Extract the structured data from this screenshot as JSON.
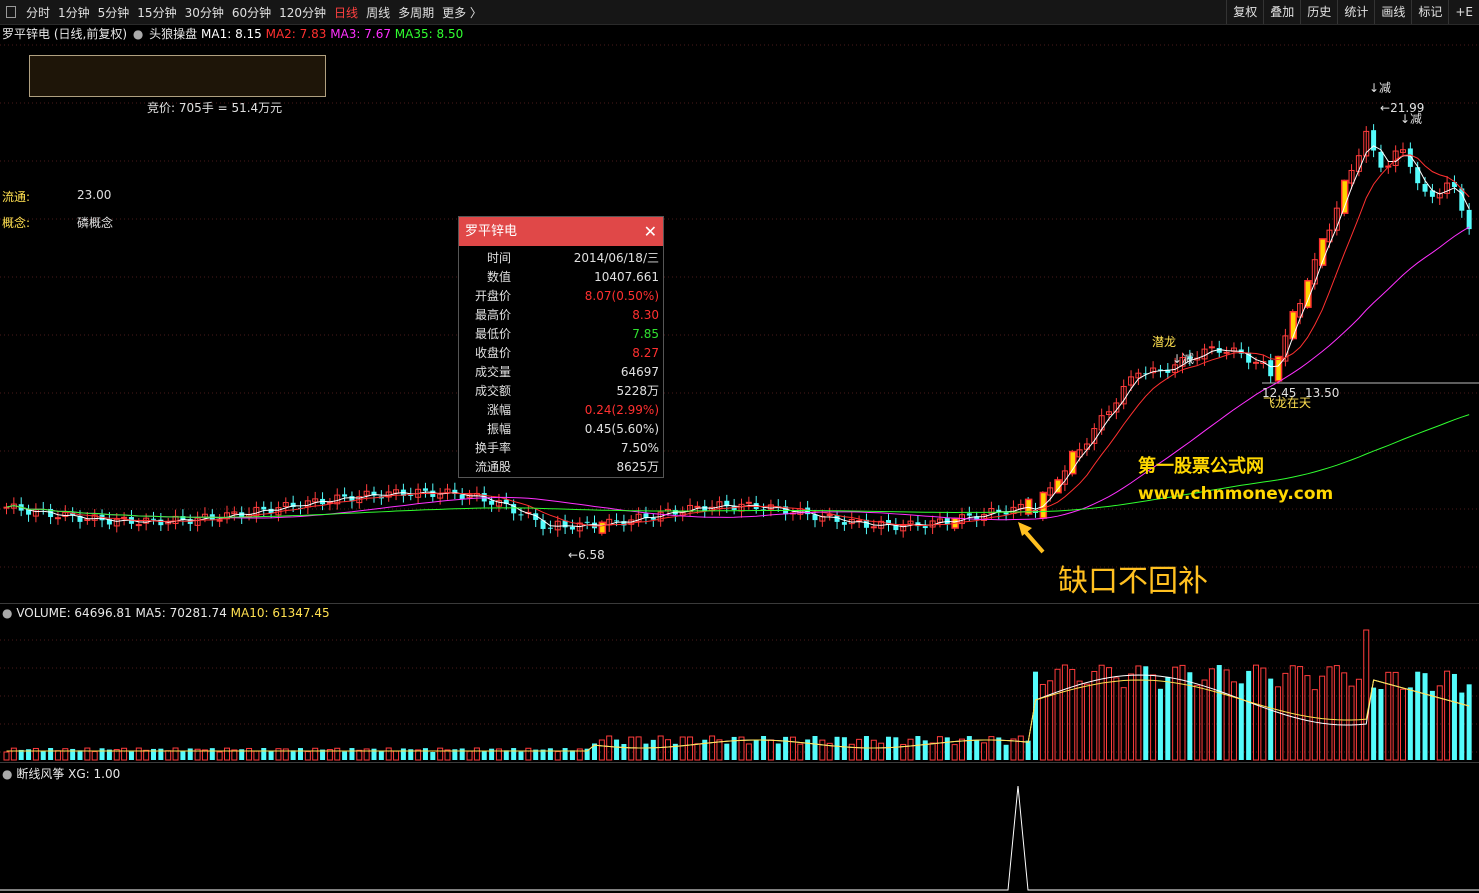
{
  "toolbar": {
    "periods": [
      "分时",
      "1分钟",
      "5分钟",
      "15分钟",
      "30分钟",
      "60分钟",
      "120分钟",
      "日线",
      "周线",
      "多周期",
      "更多 〉"
    ],
    "active_period": "日线",
    "right_buttons": [
      "复权",
      "叠加",
      "历史",
      "统计",
      "画线",
      "标记"
    ],
    "more_label": "+E"
  },
  "main_pane": {
    "stock_name": "罗平锌电",
    "period_desc": "(日线,前复权)",
    "indicator_name": "头狼操盘",
    "ma": [
      {
        "label": "MA1: 8.15",
        "color": "#ffffff"
      },
      {
        "label": "MA2: 7.83",
        "color": "#ff3030"
      },
      {
        "label": "MA3: 7.67",
        "color": "#ff30ff"
      },
      {
        "label": "MA35: 8.50",
        "color": "#30ff30"
      }
    ],
    "auction": "竞价: 705手 = 51.4万元",
    "float_label": "流通:",
    "float_value": "23.00",
    "concept_label": "概念:",
    "concept_value": "磷概念",
    "low_label": "6.58",
    "high_label": "21.99",
    "level_label_1": "12.45",
    "level_label_2": "13.50",
    "sig_qianlong": "潜龙",
    "sig_jian": "↓减",
    "sig_feilong": "飞龙在天",
    "watermark_cn": "第一股票公式网",
    "watermark_url": "www.chnmoney.com",
    "annotation": "缺口不回补"
  },
  "tooltip": {
    "title": "罗平锌电",
    "rows": [
      {
        "k": "时间",
        "v": "2014/06/18/三",
        "c": "#e0e0e0"
      },
      {
        "k": "数值",
        "v": "10407.661",
        "c": "#e0e0e0"
      },
      {
        "k": "开盘价",
        "v": "8.07(0.50%)",
        "c": "#ff3030"
      },
      {
        "k": "最高价",
        "v": "8.30",
        "c": "#ff3030"
      },
      {
        "k": "最低价",
        "v": "7.85",
        "c": "#30e030"
      },
      {
        "k": "收盘价",
        "v": "8.27",
        "c": "#ff3030"
      },
      {
        "k": "成交量",
        "v": "64697",
        "c": "#e0e0e0"
      },
      {
        "k": "成交额",
        "v": "5228万",
        "c": "#e0e0e0"
      },
      {
        "k": "涨幅",
        "v": "0.24(2.99%)",
        "c": "#ff3030"
      },
      {
        "k": "振幅",
        "v": "0.45(5.60%)",
        "c": "#e0e0e0"
      },
      {
        "k": "换手率",
        "v": "7.50%",
        "c": "#e0e0e0"
      },
      {
        "k": "流通股",
        "v": "8625万",
        "c": "#e0e0e0"
      }
    ]
  },
  "volume_pane": {
    "title": "VOLUME: 64696.81",
    "ma5": "MA5: 70281.74",
    "ma10": "MA10: 61347.45"
  },
  "signal_pane": {
    "title": "断线风筝",
    "xg": "XG: 1.00"
  },
  "colors": {
    "up": "#ff3c3c",
    "down": "#54fcfc",
    "ma1": "#ffffff",
    "ma2": "#ff3030",
    "ma3": "#ff30ff",
    "ma35": "#30ff30",
    "accent": "#ffd700"
  },
  "chart_data": {
    "type": "candlestick",
    "price_range": [
      6.58,
      21.99
    ],
    "annotated_levels": [
      6.58,
      12.45,
      13.5,
      21.99
    ],
    "tooltip_bar": {
      "date": "2014/06/18",
      "open": 8.07,
      "high": 8.3,
      "low": 7.85,
      "close": 8.27,
      "volume": 64697
    }
  }
}
